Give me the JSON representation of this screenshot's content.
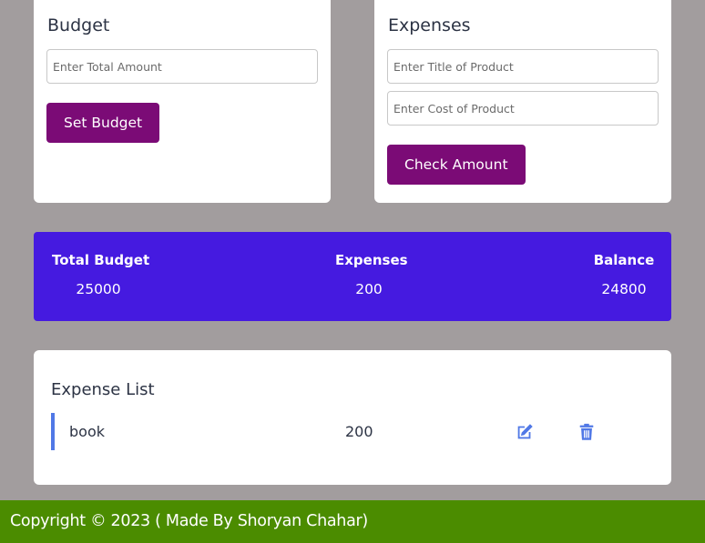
{
  "budget_card": {
    "title": "Budget",
    "amount_placeholder": "Enter Total Amount",
    "button_label": "Set Budget"
  },
  "expense_card": {
    "title": "Expenses",
    "title_placeholder": "Enter Title of Product",
    "cost_placeholder": "Enter Cost of Product",
    "button_label": "Check Amount"
  },
  "summary": {
    "total_budget_label": "Total Budget",
    "total_budget_value": "25000",
    "expenses_label": "Expenses",
    "expenses_value": "200",
    "balance_label": "Balance",
    "balance_value": "24800"
  },
  "expense_list": {
    "title": "Expense List",
    "items": [
      {
        "name": "book",
        "amount": "200",
        "edit_icon": "edit-icon",
        "delete_icon": "trash-icon"
      }
    ]
  },
  "footer": {
    "text": "Copyright © 2023 ( Made By Shoryan Chahar)"
  },
  "colors": {
    "page_background": "#a29d9e",
    "primary_button": "#7b0b76",
    "summary_background": "#451ae0",
    "accent_blue": "#5078e6",
    "footer_background": "#4b8c00"
  }
}
